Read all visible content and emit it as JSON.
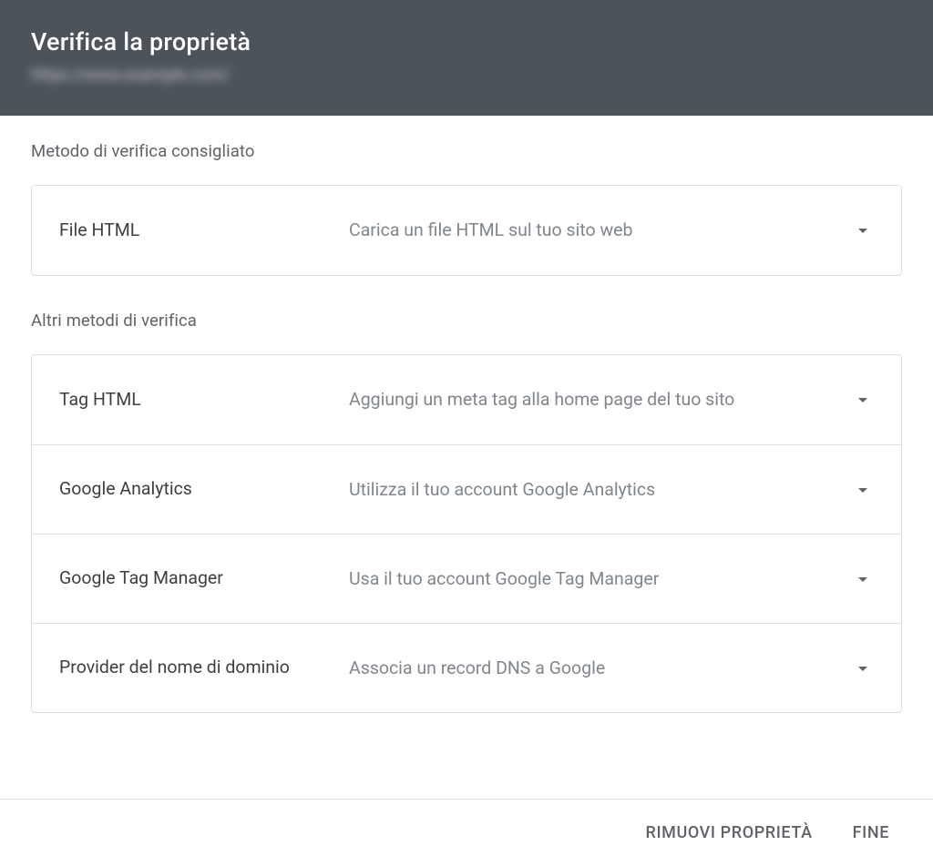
{
  "header": {
    "title": "Verifica la proprietà",
    "subtitle": "https://www.example.com/"
  },
  "sections": {
    "recommended_label": "Metodo di verifica consigliato",
    "other_label": "Altri metodi di verifica"
  },
  "recommended": [
    {
      "name": "File HTML",
      "desc": "Carica un file HTML sul tuo sito web"
    }
  ],
  "other": [
    {
      "name": "Tag HTML",
      "desc": "Aggiungi un meta tag alla home page del tuo sito"
    },
    {
      "name": "Google Analytics",
      "desc": "Utilizza il tuo account Google Analytics"
    },
    {
      "name": "Google Tag Manager",
      "desc": "Usa il tuo account Google Tag Manager"
    },
    {
      "name": "Provider del nome di dominio",
      "desc": "Associa un record DNS a Google"
    }
  ],
  "footer": {
    "remove": "RIMUOVI PROPRIETÀ",
    "done": "FINE"
  }
}
